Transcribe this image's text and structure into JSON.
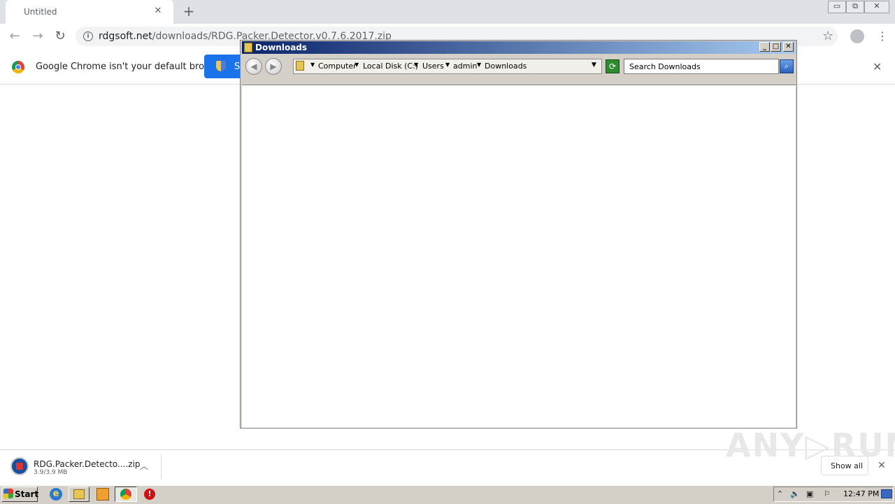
{
  "browser": {
    "tab_title": "Untitled",
    "tab_close": "✕",
    "new_tab": "+",
    "window_controls": {
      "minimize": "▭",
      "restore": "⧉",
      "close": "✕"
    },
    "url_host": "rdgsoft.net",
    "url_path": "/downloads/RDG.Packer.Detector.v0.7.6.2017.zip",
    "infobar_text": "Google Chrome isn't your default browser",
    "infobar_button_label": "S",
    "infobar_close": "✕"
  },
  "explorer": {
    "title": "Downloads",
    "title_buttons": {
      "minimize": "_",
      "maximize": "□",
      "close": "✕"
    },
    "breadcrumbs": [
      "Computer",
      "Local Disk (C:)",
      "Users",
      "admin",
      "Downloads"
    ],
    "search_placeholder": "Search Downloads"
  },
  "download_shelf": {
    "file_name": "RDG.Packer.Detecto....zip",
    "file_size": "3.9/3.9 MB",
    "show_all_label": "Show all",
    "close": "✕"
  },
  "watermark": "ANY▷RUN",
  "taskbar": {
    "start_label": "Start",
    "clock": "12:47 PM"
  },
  "colors": {
    "chrome_blue": "#1a73e8",
    "explorer_title": "#0a246a",
    "taskbar": "#d4d0c8"
  }
}
